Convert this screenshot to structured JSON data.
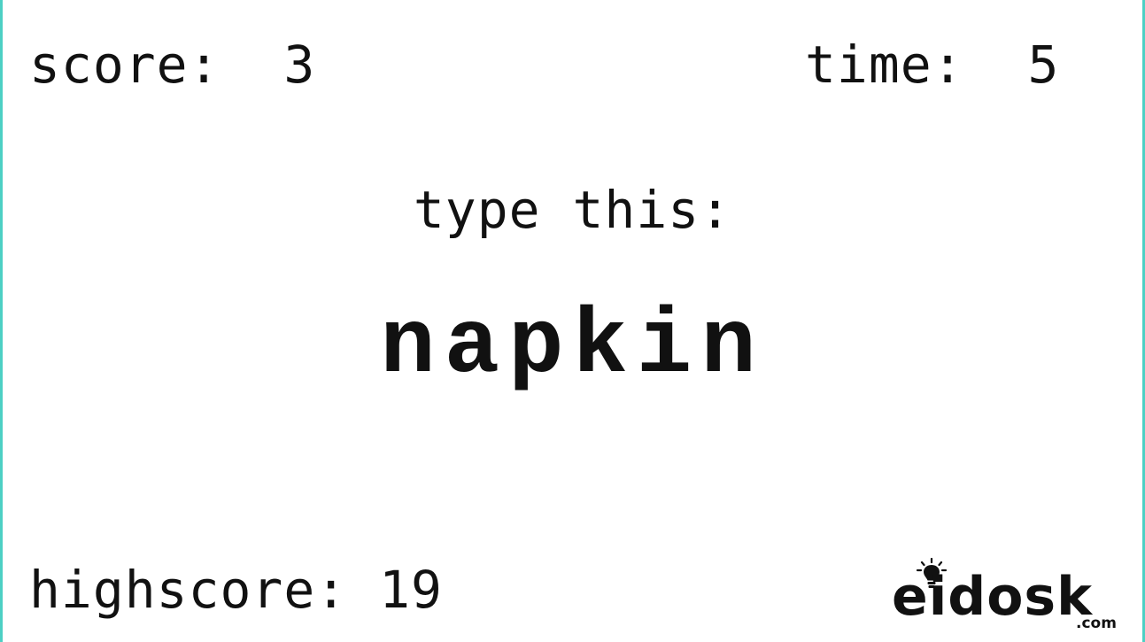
{
  "hud": {
    "score_label": "score:",
    "score_value": "3",
    "time_label": "time:",
    "time_value": "5",
    "highscore_label": "highscore:",
    "highscore_value": "19"
  },
  "prompt": {
    "label": "type this:",
    "word": "napkin"
  },
  "branding": {
    "logo_text": "eidosk",
    "logo_suffix": ".com",
    "logo_icon": "lightbulb-icon"
  },
  "colors": {
    "background": "#ffffff",
    "text": "#111111",
    "frame_border": "#4dd0c4"
  }
}
